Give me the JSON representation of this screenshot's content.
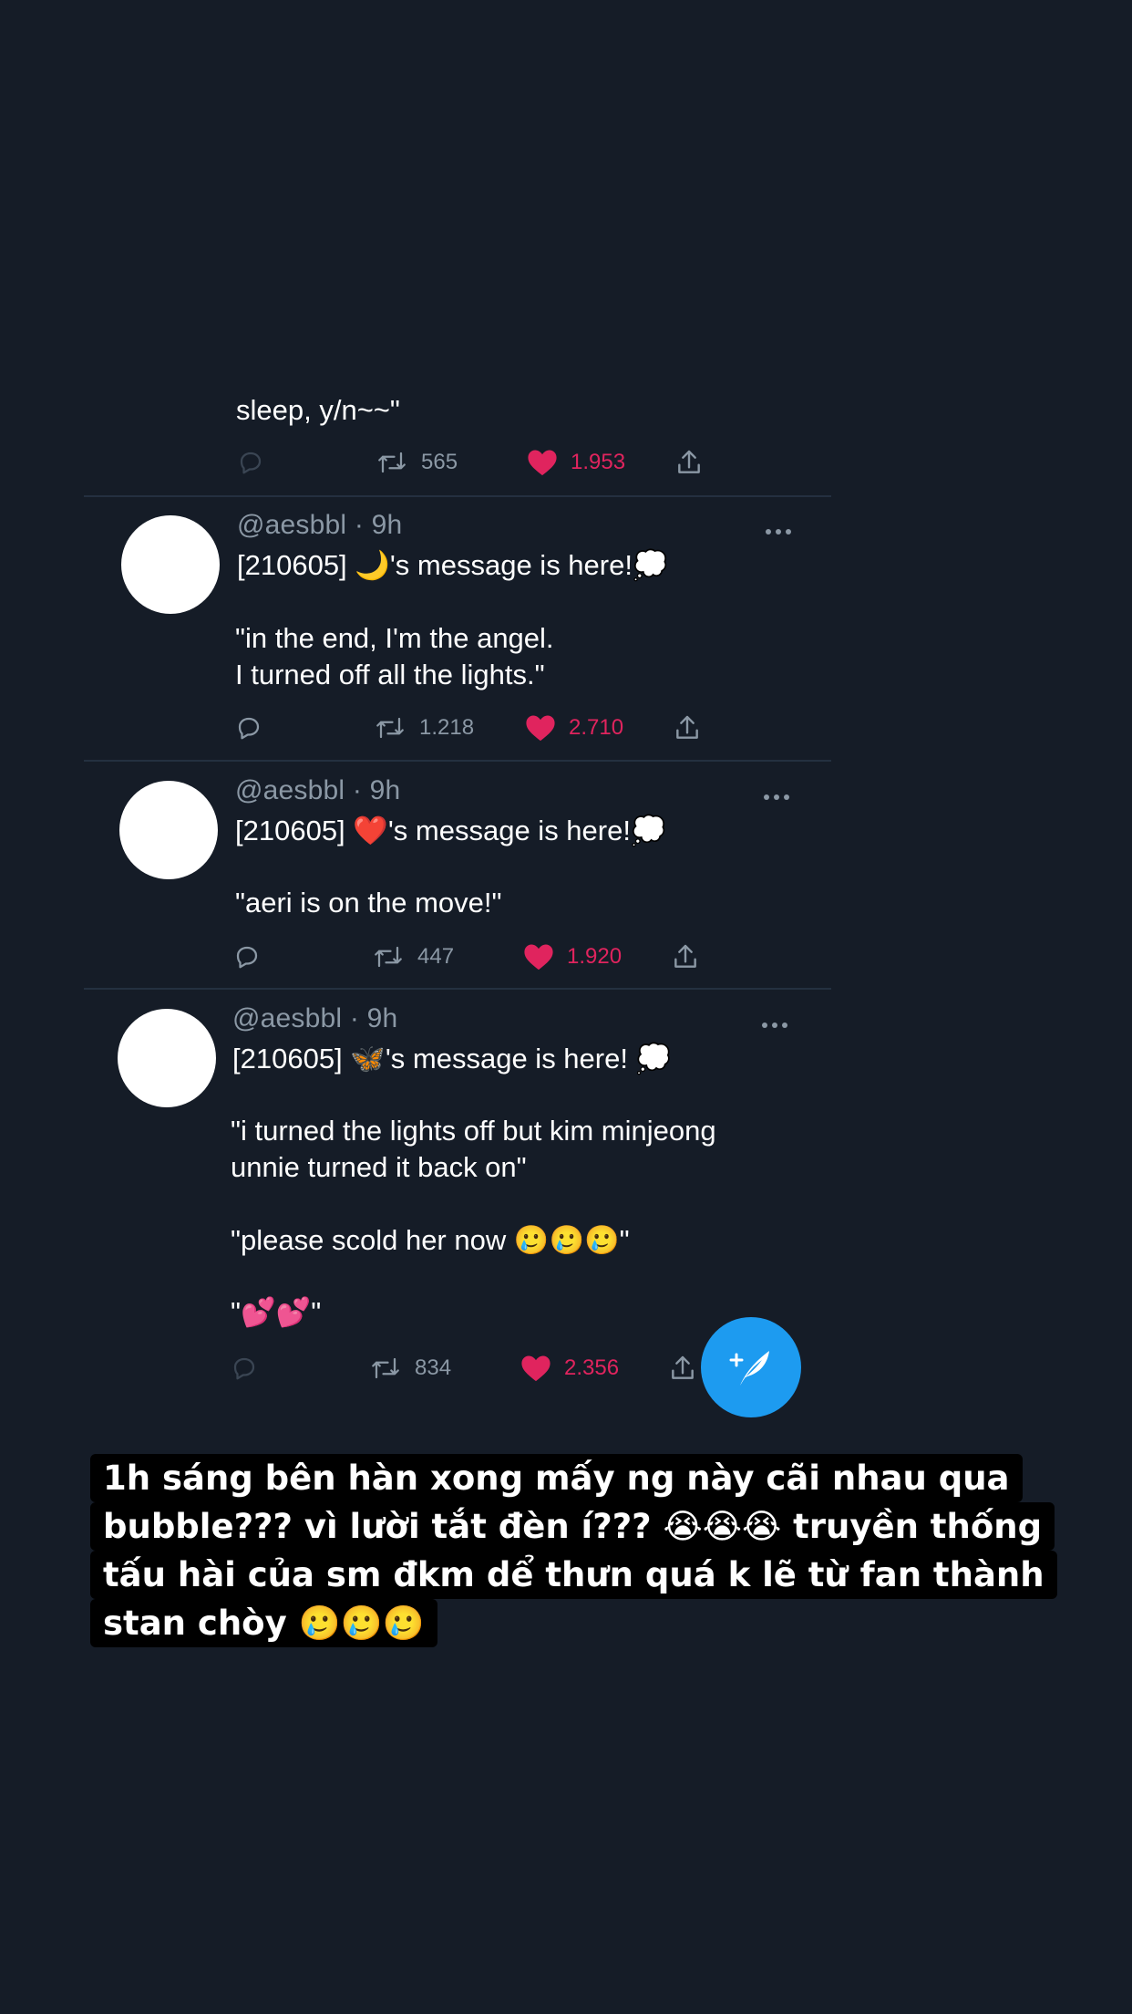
{
  "tweets": [
    {
      "lines": [
        "sleep, y/n~~\""
      ],
      "retweets": "565",
      "likes": "1.953"
    },
    {
      "handle": "@aesbbl",
      "sep": "·",
      "time": "9h",
      "lines": [
        "[210605] 🌙's message is here!💭",
        "",
        "\"in the end, I'm the angel.",
        "I turned off all the lights.\""
      ],
      "retweets": "1.218",
      "likes": "2.710"
    },
    {
      "handle": "@aesbbl",
      "sep": "·",
      "time": "9h",
      "lines": [
        "[210605] ❤️'s message is here!💭",
        "",
        "\"aeri is on the move!\""
      ],
      "retweets": "447",
      "likes": "1.920"
    },
    {
      "handle": "@aesbbl",
      "sep": "·",
      "time": "9h",
      "lines": [
        "[210605] 🦋's message is here! 💭",
        "",
        "\"i turned the lights off but kim minjeong",
        "unnie turned it back on\"",
        "",
        "\"please scold her now 🥲🥲🥲\"",
        "",
        "\"💕💕\""
      ],
      "retweets": "834",
      "likes": "2.356"
    }
  ],
  "caption": [
    "1h sáng bên hàn xong mấy ng này cãi nhau qua",
    "bubble??? vì lười tắt đèn í??? 😭😭😭 truyền thống",
    "tấu hài của sm đkm dể thưn quá k lẽ từ fan thành",
    "stan chòy 🥲🥲🥲"
  ],
  "colors": {
    "background": "#151c27",
    "like": "#e0245e",
    "muted": "#8b98a5",
    "fab": "#1d9bf0"
  },
  "icons": [
    "reply-icon",
    "retweet-icon",
    "heart-icon",
    "share-icon",
    "more-icon",
    "compose-icon"
  ]
}
